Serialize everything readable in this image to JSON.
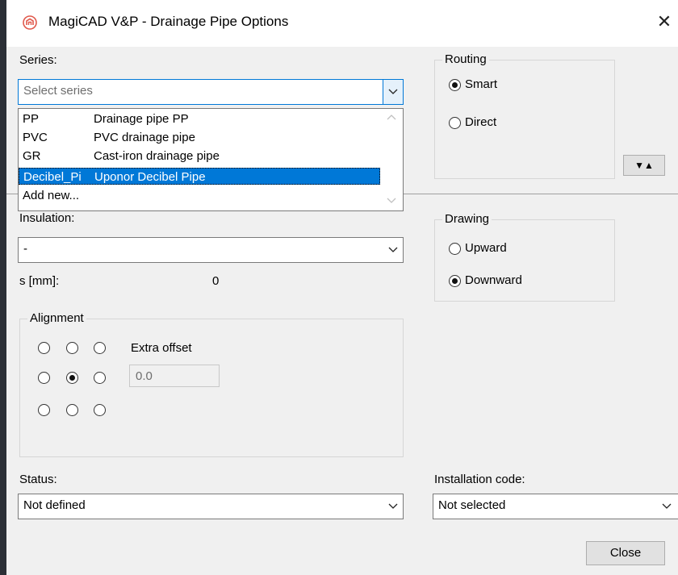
{
  "window": {
    "title": "MagiCAD V&P - Drainage Pipe Options",
    "close_symbol": "✕"
  },
  "series": {
    "label": "Series:",
    "placeholder": "Select series",
    "options": [
      {
        "code": "PP",
        "name": "Drainage pipe PP",
        "selected": false
      },
      {
        "code": "PVC",
        "name": "PVC drainage pipe",
        "selected": false
      },
      {
        "code": "GR",
        "name": "Cast-iron drainage pipe",
        "selected": false
      },
      {
        "code": "Decibel_Pi",
        "name": "Uponor Decibel Pipe",
        "selected": true
      },
      {
        "code": "Add new...",
        "name": "",
        "selected": false
      }
    ]
  },
  "routing": {
    "title": "Routing",
    "options": [
      {
        "label": "Smart",
        "checked": true
      },
      {
        "label": "Direct",
        "checked": false
      }
    ]
  },
  "toggle_button": {
    "label": "▼▲"
  },
  "insulation": {
    "label": "Insulation:",
    "value": "-",
    "thickness_label": "s [mm]:",
    "thickness_value": "0"
  },
  "drawing": {
    "title": "Drawing",
    "options": [
      {
        "label": "Upward",
        "checked": false
      },
      {
        "label": "Downward",
        "checked": true
      }
    ]
  },
  "alignment": {
    "title": "Alignment",
    "selected": [
      1,
      1
    ],
    "extra_offset_label": "Extra offset",
    "extra_offset_value": "0.0"
  },
  "status": {
    "label": "Status:",
    "value": "Not defined"
  },
  "installation_code": {
    "label": "Installation code:",
    "value": "Not selected"
  },
  "close_button": {
    "label": "Close"
  },
  "icons": {
    "app": "magicad-logo-icon",
    "dropdown": "chevron-down-icon",
    "scroll_up": "scroll-up-arrow-icon",
    "scroll_down": "scroll-down-arrow-icon"
  },
  "colors": {
    "selection": "#0078d7",
    "window_bg": "#f0f0f0",
    "brand": "#e0584b"
  }
}
